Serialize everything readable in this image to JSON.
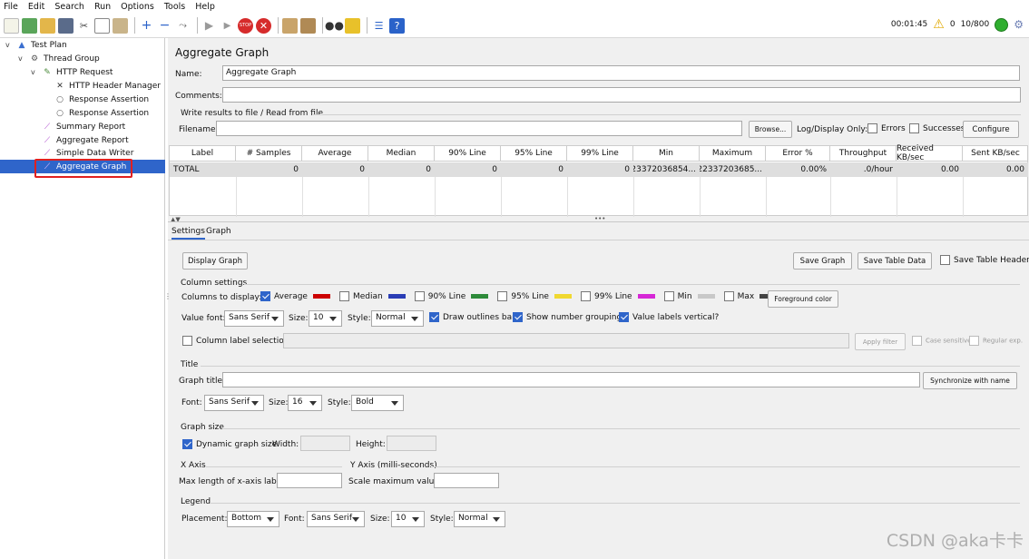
{
  "menu": [
    "File",
    "Edit",
    "Search",
    "Run",
    "Options",
    "Tools",
    "Help"
  ],
  "toolbar": {
    "timer": "00:01:45",
    "warnings": "0",
    "threads": "10/800",
    "icons": [
      "new-icon",
      "templates-icon",
      "open-icon",
      "save-icon",
      "cut-icon",
      "copy-icon",
      "paste-icon",
      "expand-icon",
      "collapse-icon",
      "toggle-icon",
      "start-icon",
      "start-no-pause-icon",
      "stop-icon",
      "shutdown-icon",
      "clear-icon",
      "clear-all-icon",
      "search-icon",
      "reset-search-icon",
      "function-helper-icon",
      "help-icon"
    ]
  },
  "tree": [
    {
      "label": "Test Plan",
      "icon": "test-plan-icon"
    },
    {
      "label": "Thread Group",
      "icon": "gear-icon"
    },
    {
      "label": "HTTP Request",
      "icon": "pipette-icon"
    },
    {
      "label": "HTTP Header Manager",
      "icon": "wrench-icon"
    },
    {
      "label": "Response Assertion",
      "icon": "magnifier-icon"
    },
    {
      "label": "Response Assertion",
      "icon": "magnifier-icon"
    },
    {
      "label": "Summary Report",
      "icon": "graph-icon"
    },
    {
      "label": "Aggregate Report",
      "icon": "graph-icon"
    },
    {
      "label": "Simple Data Writer",
      "icon": "graph-icon"
    },
    {
      "label": "Aggregate Graph",
      "icon": "graph-icon"
    }
  ],
  "panel": {
    "title": "Aggregate Graph",
    "name_label": "Name:",
    "name_value": "Aggregate Graph",
    "comments_label": "Comments:",
    "comments_value": "",
    "write_results_legend": "Write results to file / Read from file",
    "filename_label": "Filename",
    "filename_value": "",
    "browse": "Browse...",
    "log_display_only": "Log/Display Only:",
    "errors": "Errors",
    "successes": "Successes",
    "configure": "Configure"
  },
  "table": {
    "headers": [
      "Label",
      "# Samples",
      "Average",
      "Median",
      "90% Line",
      "95% Line",
      "99% Line",
      "Min",
      "Maximum",
      "Error %",
      "Throughput",
      "Received KB/sec",
      "Sent KB/sec"
    ],
    "rows": [
      [
        "TOTAL",
        "0",
        "0",
        "0",
        "0",
        "0",
        "0",
        "9223372036854...",
        "-922337203685...",
        "0.00%",
        ".0/hour",
        "0.00",
        "0.00"
      ]
    ]
  },
  "tabs": [
    "Settings",
    "Graph"
  ],
  "settings": {
    "display_graph": "Display Graph",
    "save_graph": "Save Graph",
    "save_table_data": "Save Table Data",
    "save_table_header": "Save Table Header",
    "column_settings": "Column settings",
    "columns_to_display": "Columns to display:",
    "columns": [
      {
        "label": "Average",
        "checked": true,
        "color": "#cc0000"
      },
      {
        "label": "Median",
        "checked": false,
        "color": "#2a3db5"
      },
      {
        "label": "90% Line",
        "checked": false,
        "color": "#2e8b3a"
      },
      {
        "label": "95% Line",
        "checked": false,
        "color": "#f0d830"
      },
      {
        "label": "99% Line",
        "checked": false,
        "color": "#d627d6"
      },
      {
        "label": "Min",
        "checked": false,
        "color": "#c8c8c8"
      },
      {
        "label": "Max",
        "checked": false,
        "color": "#444444"
      }
    ],
    "foreground_color": "Foreground color",
    "value_font": "Value font:",
    "value_font_family": "Sans Serif",
    "size_label": "Size:",
    "value_font_size": "10",
    "style_label": "Style:",
    "value_font_style": "Normal",
    "draw_outlines": "Draw outlines bar?",
    "show_number_grouping": "Show number grouping?",
    "value_labels_vertical": "Value labels vertical?",
    "column_label_selection": "Column label selection:",
    "apply_filter": "Apply filter",
    "case_sensitive": "Case sensitive",
    "regular_exp": "Regular exp.",
    "title_section": "Title",
    "graph_title": "Graph title:",
    "graph_title_value": "",
    "synchronize_with_name": "Synchronize with name",
    "font_label": "Font:",
    "title_font_family": "Sans Serif",
    "title_font_size": "16",
    "title_font_style": "Bold",
    "graph_size": "Graph size",
    "dynamic_graph_size": "Dynamic graph size",
    "width_label": "Width:",
    "height_label": "Height:",
    "x_axis": "X Axis",
    "y_axis": "Y Axis (milli-seconds)",
    "max_length_x": "Max length of x-axis label:",
    "scale_max": "Scale maximum value:",
    "legend": "Legend",
    "placement_label": "Placement:",
    "placement_value": "Bottom",
    "legend_font_family": "Sans Serif",
    "legend_font_size": "10",
    "legend_font_style": "Normal"
  },
  "watermark": "CSDN @aka卡卡"
}
